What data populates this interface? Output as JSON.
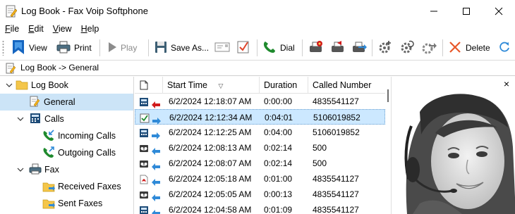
{
  "window": {
    "title": "Log Book - Fax Voip Softphone"
  },
  "menu": [
    {
      "label": "File",
      "accel": "F",
      "rest": "ile"
    },
    {
      "label": "Edit",
      "accel": "E",
      "rest": "dit"
    },
    {
      "label": "View",
      "accel": "V",
      "rest": "iew"
    },
    {
      "label": "Help",
      "accel": "H",
      "rest": "elp"
    }
  ],
  "toolbar": {
    "view_label": "View",
    "print_label": "Print",
    "play_label": "Play",
    "save_as_label": "Save As...",
    "dial_label": "Dial",
    "delete_label": "Delete"
  },
  "address": {
    "path": "Log Book -> General"
  },
  "tree": {
    "root": "Log Book",
    "general": "General",
    "calls": "Calls",
    "incoming_calls": "Incoming Calls",
    "outgoing_calls": "Outgoing Calls",
    "fax": "Fax",
    "received_faxes": "Received Faxes",
    "sent_faxes": "Sent Faxes"
  },
  "grid": {
    "columns": {
      "start_time": "Start Time",
      "duration": "Duration",
      "called_number": "Called Number"
    },
    "sort_indicator": "▽",
    "rows": [
      {
        "type": "fax-out",
        "direction": "left",
        "start": "6/2/2024 12:18:07 AM",
        "duration": "0:00:00",
        "number": "4835541127"
      },
      {
        "type": "checked",
        "direction": "right",
        "start": "6/2/2024 12:12:34 AM",
        "duration": "0:04:01",
        "number": "5106019852"
      },
      {
        "type": "fax",
        "direction": "right",
        "start": "6/2/2024 12:12:25 AM",
        "duration": "0:04:00",
        "number": "5106019852"
      },
      {
        "type": "voice",
        "direction": "left",
        "start": "6/2/2024 12:08:13 AM",
        "duration": "0:02:14",
        "number": "500"
      },
      {
        "type": "voice",
        "direction": "left",
        "start": "6/2/2024 12:08:07 AM",
        "duration": "0:02:14",
        "number": "500"
      },
      {
        "type": "pdf",
        "direction": "left",
        "start": "6/2/2024 12:05:18 AM",
        "duration": "0:01:00",
        "number": "4835541127"
      },
      {
        "type": "voice",
        "direction": "left",
        "start": "6/2/2024 12:05:05 AM",
        "duration": "0:00:13",
        "number": "4835541127"
      },
      {
        "type": "fax",
        "direction": "left",
        "start": "6/2/2024 12:04:58 AM",
        "duration": "0:01:09",
        "number": "4835541127"
      }
    ]
  },
  "colors": {
    "selection": "#cce8ff",
    "tree_selection": "#cce4f7",
    "arrow_blue": "#2f8ad8",
    "arrow_red": "#d11b1b",
    "dial_green": "#1f8a2e"
  },
  "preview": {
    "close_label": "×"
  }
}
